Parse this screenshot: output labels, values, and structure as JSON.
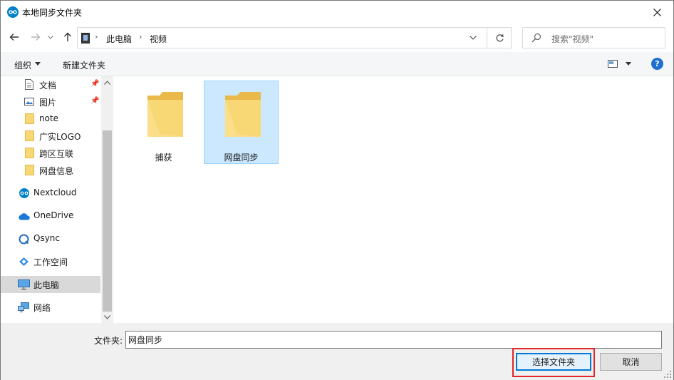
{
  "window": {
    "title": "本地同步文件夹",
    "app_icon": "nextcloud-icon",
    "close_icon": "close-icon"
  },
  "nav": {
    "back_icon": "arrow-left-icon",
    "forward_icon": "arrow-right-icon",
    "recent_icon": "chevron-down-icon",
    "up_icon": "arrow-up-icon",
    "breadcrumb": [
      "此电脑",
      "视频"
    ],
    "refresh_icon": "refresh-icon",
    "search_placeholder": "搜索\"视频\""
  },
  "toolbar": {
    "organize_label": "组织",
    "new_folder_label": "新建文件夹",
    "help_label": "?"
  },
  "sidebar": {
    "items": [
      {
        "label": "文档",
        "icon": "document-icon",
        "pinned": true
      },
      {
        "label": "图片",
        "icon": "picture-icon",
        "pinned": true
      },
      {
        "label": "note",
        "icon": "folder-icon"
      },
      {
        "label": "广实LOGO",
        "icon": "folder-icon"
      },
      {
        "label": "跨区互联",
        "icon": "folder-icon"
      },
      {
        "label": "网盘信息",
        "icon": "folder-icon"
      },
      {
        "label": "Nextcloud",
        "icon": "nextcloud-icon"
      },
      {
        "label": "OneDrive",
        "icon": "onedrive-icon"
      },
      {
        "label": "Qsync",
        "icon": "qsync-icon"
      },
      {
        "label": "工作空间",
        "icon": "workspace-icon"
      },
      {
        "label": "此电脑",
        "icon": "computer-icon",
        "selected": true
      },
      {
        "label": "网络",
        "icon": "network-icon"
      }
    ]
  },
  "content": {
    "folders": [
      {
        "name": "捕获",
        "selected": false
      },
      {
        "name": "网盘同步",
        "selected": true
      }
    ]
  },
  "footer": {
    "folder_label": "文件夹:",
    "folder_value": "网盘同步",
    "select_button": "选择文件夹",
    "cancel_button": "取消"
  },
  "colors": {
    "accent": "#0078d7",
    "selection": "#cce8ff",
    "highlight_ring": "#e0262a",
    "folder": "#f8d775"
  }
}
